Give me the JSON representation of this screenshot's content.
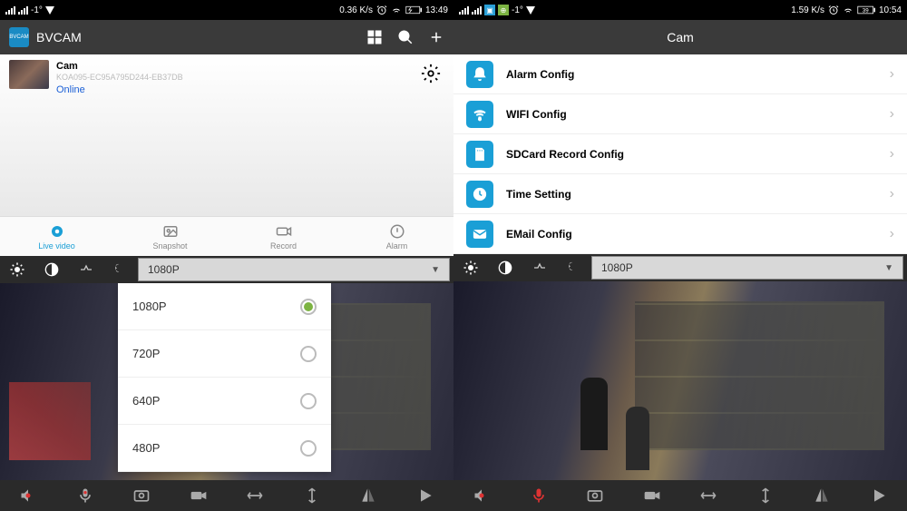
{
  "left": {
    "status": {
      "temp": "-1°",
      "speed": "0.36 K/s",
      "time": "13:49"
    },
    "app_name": "BVCAM",
    "device": {
      "name": "Cam",
      "id": "KOA095-EC95A795D244-EB37DB",
      "status": "Online"
    },
    "tabs": [
      {
        "label": "Live video",
        "active": true
      },
      {
        "label": "Snapshot",
        "active": false
      },
      {
        "label": "Record",
        "active": false
      },
      {
        "label": "Alarm",
        "active": false
      }
    ],
    "resolution": {
      "current": "1080P",
      "options": [
        "1080P",
        "720P",
        "640P",
        "480P"
      ],
      "selected": "1080P"
    }
  },
  "right": {
    "status": {
      "temp": "-1°",
      "speed": "1.59 K/s",
      "time": "10:54",
      "battery": "39"
    },
    "title": "Cam",
    "config": [
      {
        "label": "Alarm Config"
      },
      {
        "label": "WIFI Config"
      },
      {
        "label": "SDCard Record Config"
      },
      {
        "label": "Time Setting"
      },
      {
        "label": "EMail Config"
      }
    ],
    "resolution": {
      "current": "1080P"
    }
  }
}
